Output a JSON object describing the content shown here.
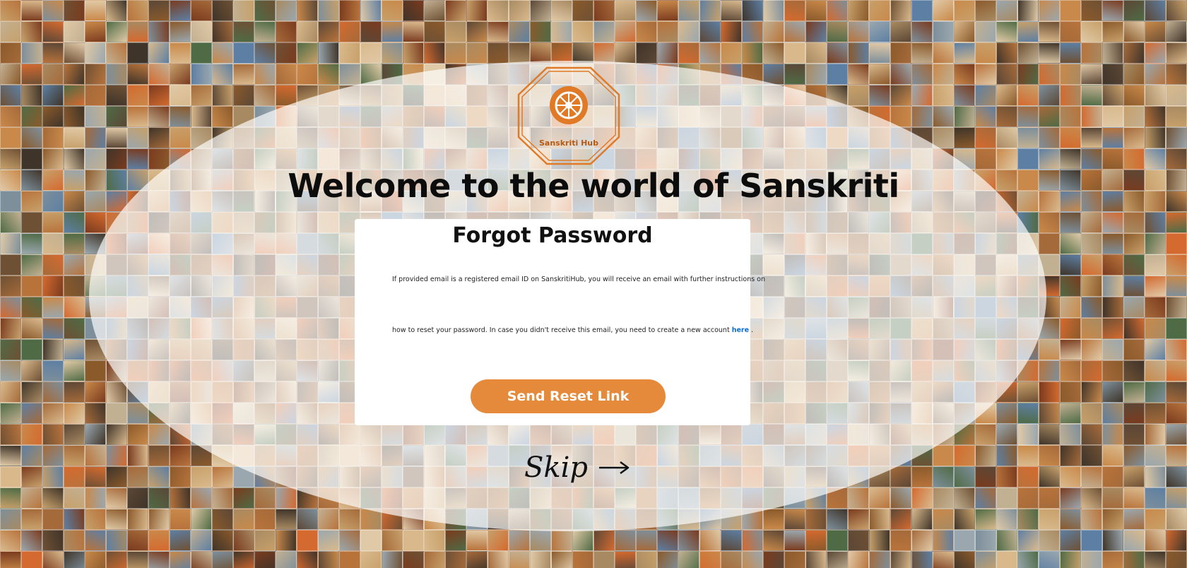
{
  "colors": {
    "accent": "#e58a3b",
    "link": "#0a6fd0",
    "logo": "#e07a26"
  },
  "logo": {
    "text": "Sanskriti Hub",
    "icon": "dharma-wheel-icon"
  },
  "welcome_title": "Welcome to the world of Sanskriti",
  "card": {
    "title": "Forgot Password",
    "info_line1": "If provided email is a registered email ID on SanskritiHub, you will receive an email with further instructions on",
    "info_line2": "how to reset your password. In case you didn't receive this email, you need to create a new account",
    "link_text": "here",
    "trailing": " .",
    "button_label": "Send Reset Link"
  },
  "skip": {
    "label": "Skip",
    "icon": "arrow-right-icon"
  }
}
